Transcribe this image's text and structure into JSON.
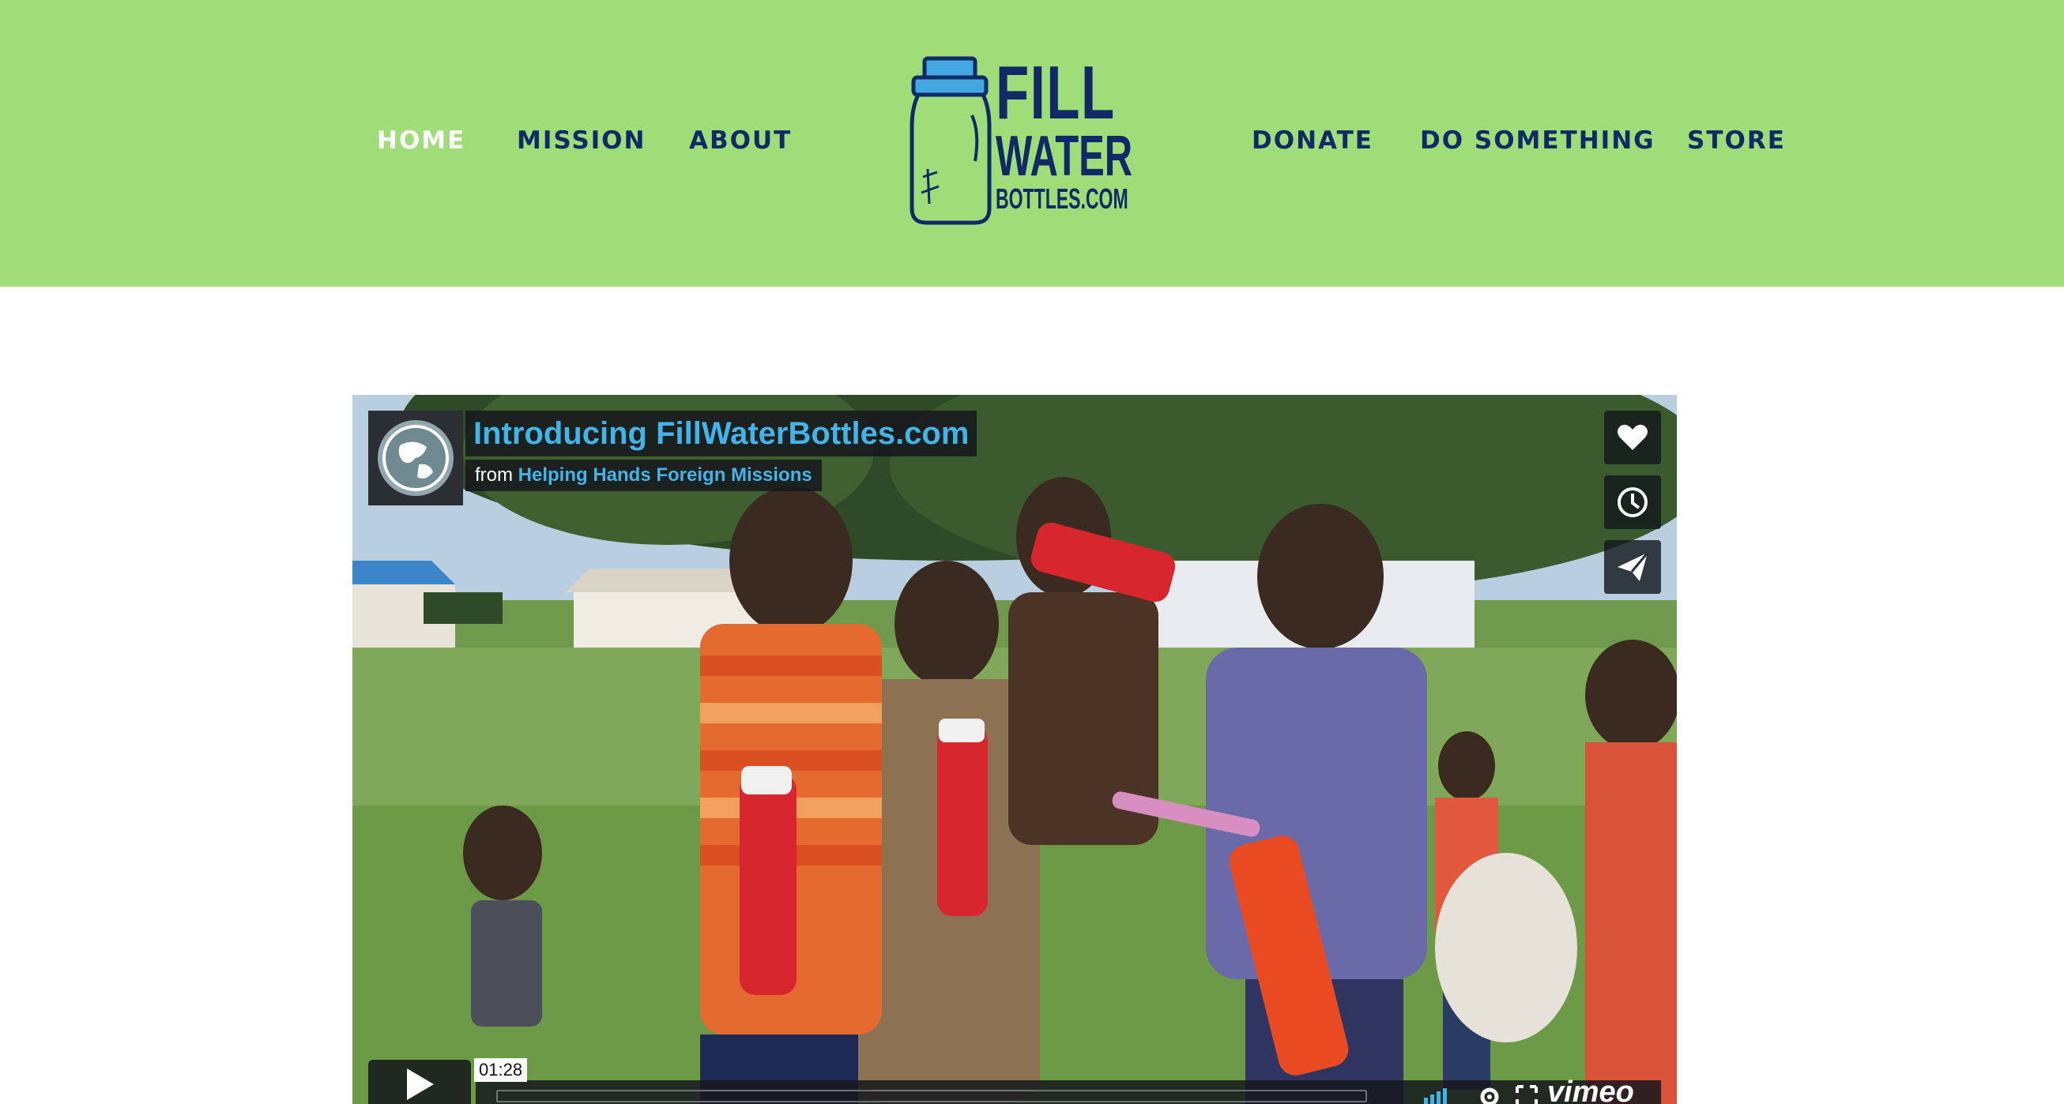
{
  "nav": {
    "left": [
      "HOME",
      "MISSION",
      "ABOUT"
    ],
    "right": [
      "DONATE",
      "DO SOMETHING",
      "STORE"
    ],
    "active": "HOME"
  },
  "logo": {
    "line1": "FILL",
    "line2": "WATER",
    "line3": "BOTTLES.COM"
  },
  "video": {
    "title": "Introducing FillWaterBottles.com",
    "byline_prefix": "from",
    "owner": "Helping Hands Foreign Missions",
    "duration": "01:28",
    "brand": "vimeo",
    "side_icons": [
      "heart-icon",
      "clock-icon",
      "paper-plane-icon"
    ]
  },
  "colors": {
    "header_bg": "#9fdd78",
    "nav_text": "#0f2a66",
    "nav_active": "#ffffff",
    "video_title": "#44b3e8"
  }
}
